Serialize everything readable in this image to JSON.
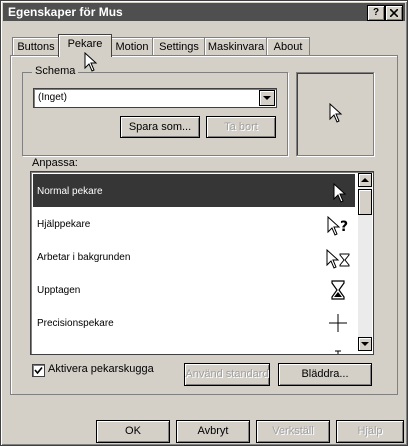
{
  "window": {
    "title": "Egenskaper för Mus",
    "help_glyph": "?",
    "close_glyph": "X"
  },
  "tabs": [
    "Buttons",
    "Pekare",
    "Motion",
    "Settings",
    "Maskinvara",
    "About"
  ],
  "active_tab": "Pekare",
  "schema": {
    "label": "Schema",
    "selected": "(Inget)",
    "save_label": "Spara som...",
    "delete_label": "Ta bort"
  },
  "customize": {
    "label": "Anpassa:",
    "items": [
      {
        "label": "Normal pekare",
        "icon": "arrow-cursor-icon",
        "selected": true
      },
      {
        "label": "Hjälppekare",
        "icon": "help-cursor-icon",
        "selected": false
      },
      {
        "label": "Arbetar i bakgrunden",
        "icon": "working-background-cursor-icon",
        "selected": false
      },
      {
        "label": "Upptagen",
        "icon": "hourglass-icon",
        "selected": false
      },
      {
        "label": "Precisionspekare",
        "icon": "crosshair-icon",
        "selected": false
      },
      {
        "label": "",
        "icon": "text-select-cursor-icon",
        "selected": false
      }
    ]
  },
  "shadow": {
    "label": "Aktivera pekarskugga",
    "checked": true
  },
  "buttons": {
    "default_label": "Använd standard",
    "browse_label": "Bläddra...",
    "ok_label": "OK",
    "cancel_label": "Avbryt",
    "apply_label": "Verkställ",
    "help_label": "Hjälp"
  }
}
